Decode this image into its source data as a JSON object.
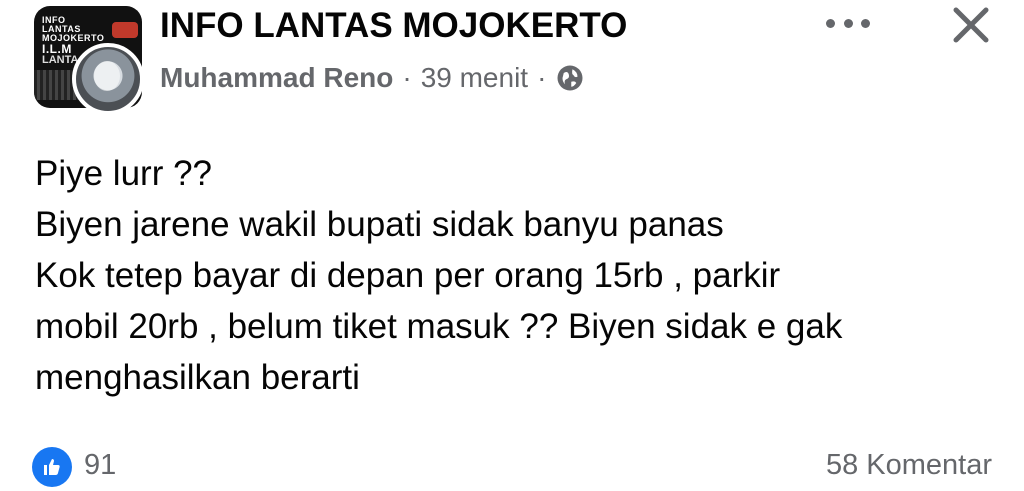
{
  "header": {
    "group_name": "INFO LANTAS MOJOKERTO",
    "author": "Muhammad Reno",
    "separator": "·",
    "time": "39 menit",
    "privacy_icon": "globe-icon",
    "more_icon": "more-horizontal-icon",
    "close_icon": "close-icon"
  },
  "group_avatar": {
    "logo_lines": [
      "INFO",
      "LANTAS",
      "MOJOKERTO",
      "I.L.M"
    ],
    "sub_text": "LANTA"
  },
  "post": {
    "lines": [
      "Piye lurr ??",
      "Biyen jarene wakil bupati sidak banyu panas",
      "Kok tetep bayar di depan per orang 15rb , parkir",
      "mobil 20rb , belum tiket masuk ?? Biyen sidak e gak",
      "menghasilkan berarti"
    ]
  },
  "footer": {
    "like_icon": "thumbs-up-icon",
    "like_count": "91",
    "comments": "58 Komentar"
  },
  "colors": {
    "primary_text": "#050505",
    "secondary_text": "#65676b",
    "like_blue": "#1877f2"
  }
}
